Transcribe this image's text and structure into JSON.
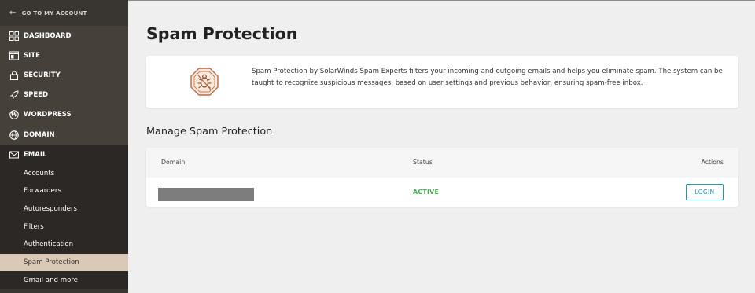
{
  "sidebar": {
    "back_label": "GO TO MY ACCOUNT",
    "items": [
      {
        "label": "DASHBOARD",
        "icon": "dashboard-grid-icon"
      },
      {
        "label": "SITE",
        "icon": "site-window-icon"
      },
      {
        "label": "SECURITY",
        "icon": "lock-icon"
      },
      {
        "label": "SPEED",
        "icon": "rocket-icon"
      },
      {
        "label": "WORDPRESS",
        "icon": "wordpress-icon"
      },
      {
        "label": "DOMAIN",
        "icon": "globe-icon"
      },
      {
        "label": "EMAIL",
        "icon": "envelope-icon"
      }
    ],
    "email_subitems": [
      "Accounts",
      "Forwarders",
      "Autoresponders",
      "Filters",
      "Authentication",
      "Spam Protection",
      "Gmail and more"
    ],
    "active_subitem": "Spam Protection"
  },
  "main": {
    "title": "Spam Protection",
    "info_text": "Spam Protection by SolarWinds Spam Experts filters your incoming and outgoing emails and helps you eliminate spam. The system can be taught to recognize suspicious messages, based on user settings and previous behavior, ensuring spam-free inbox.",
    "info_icon": "bug-stop-icon",
    "section_title": "Manage Spam Protection",
    "table": {
      "headers": {
        "domain": "Domain",
        "status": "Status",
        "actions": "Actions"
      },
      "rows": [
        {
          "status": "ACTIVE",
          "action": "LOGIN"
        }
      ]
    }
  },
  "colors": {
    "sidebar_bg": "#393632",
    "active_item_bg": "#d9c9b6",
    "status_active": "#3bb44a",
    "login_accent": "#15a0b5",
    "icon_accent": "#c0784f"
  }
}
